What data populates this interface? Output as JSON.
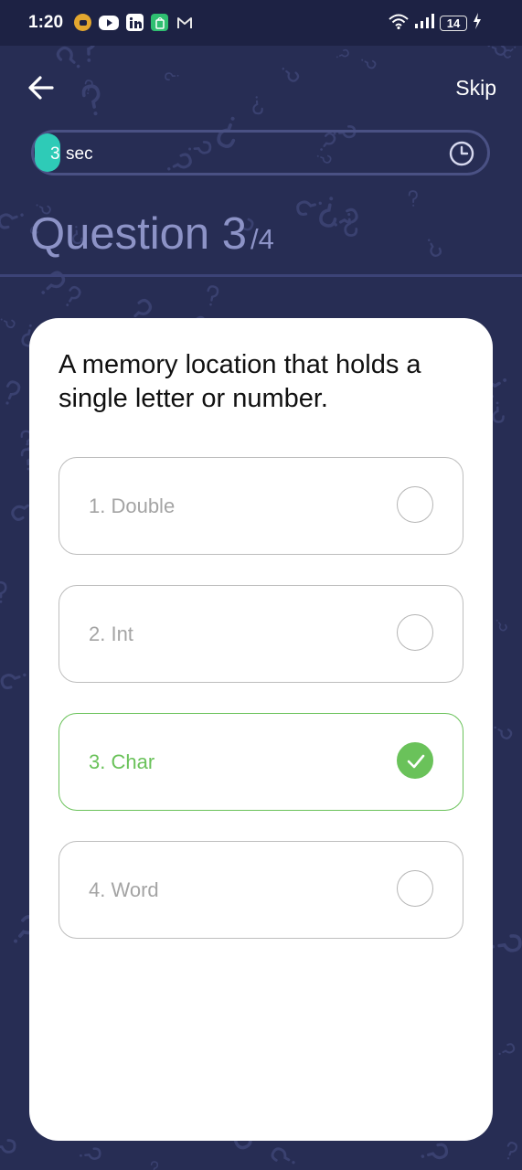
{
  "status_bar": {
    "time": "1:20",
    "battery": "14",
    "notification_icons": [
      "notification-app-icon",
      "youtube-icon",
      "linkedin-icon",
      "shopping-bag-icon",
      "gmail-icon"
    ],
    "right_icons": [
      "wifi-icon",
      "signal-icon",
      "battery-icon",
      "charging-icon"
    ]
  },
  "header": {
    "back_icon": "arrow-left-icon",
    "skip_label": "Skip"
  },
  "timer": {
    "value": "3",
    "unit": "sec",
    "icon": "clock-icon",
    "fill_color": "#2ecbb7"
  },
  "question": {
    "title": "Question 3",
    "total": "/4",
    "text": "A memory location that holds a single letter or number."
  },
  "options": [
    {
      "label": "1. Double",
      "selected": false
    },
    {
      "label": "2. Int",
      "selected": false
    },
    {
      "label": "3. Char",
      "selected": true
    },
    {
      "label": "4. Word",
      "selected": false
    }
  ],
  "colors": {
    "background": "#272d54",
    "accent_teal": "#2ecbb7",
    "selected_green": "#6ac25a",
    "title_color": "#8d93c7"
  }
}
